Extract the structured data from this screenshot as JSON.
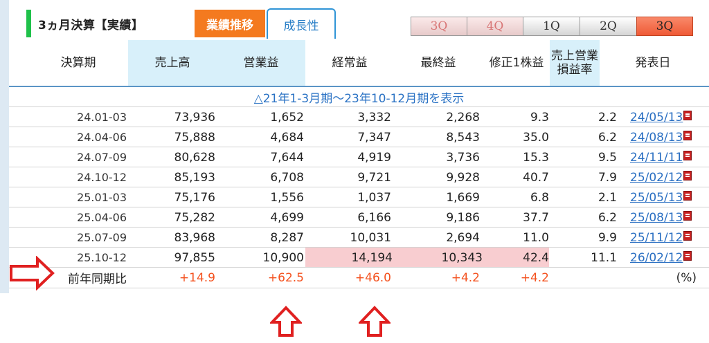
{
  "header": {
    "title": "3ヵ月決算【実績】",
    "tab_active": "業績推移",
    "tab_inactive": "成長性",
    "quarter_tabs": [
      "3Q",
      "4Q",
      "1Q",
      "2Q",
      "3Q"
    ]
  },
  "table": {
    "headers": [
      "決算期",
      "売上高",
      "営業益",
      "経常益",
      "最終益",
      "修正1株益",
      "売上営業\n損益率",
      "発表日"
    ],
    "period_note": "△21年1-3月期～23年10-12月期を表示",
    "rows": [
      {
        "period": "24.01-03",
        "sales": "73,936",
        "operating": "1,652",
        "ordinary": "3,332",
        "net": "2,268",
        "eps": "9.3",
        "margin": "2.2",
        "date": "24/05/13"
      },
      {
        "period": "24.04-06",
        "sales": "75,888",
        "operating": "4,684",
        "ordinary": "7,347",
        "net": "8,543",
        "eps": "35.0",
        "margin": "6.2",
        "date": "24/08/13"
      },
      {
        "period": "24.07-09",
        "sales": "80,628",
        "operating": "7,644",
        "ordinary": "4,919",
        "net": "3,736",
        "eps": "15.3",
        "margin": "9.5",
        "date": "24/11/11"
      },
      {
        "period": "24.10-12",
        "sales": "85,193",
        "operating": "6,708",
        "ordinary": "9,721",
        "net": "9,928",
        "eps": "40.7",
        "margin": "7.9",
        "date": "25/02/12"
      },
      {
        "period": "25.01-03",
        "sales": "75,176",
        "operating": "1,556",
        "ordinary": "1,037",
        "net": "1,669",
        "eps": "6.8",
        "margin": "2.1",
        "date": "25/05/13"
      },
      {
        "period": "25.04-06",
        "sales": "75,282",
        "operating": "4,699",
        "ordinary": "6,166",
        "net": "9,186",
        "eps": "37.7",
        "margin": "6.2",
        "date": "25/08/13"
      },
      {
        "period": "25.07-09",
        "sales": "83,968",
        "operating": "8,287",
        "ordinary": "10,031",
        "net": "2,694",
        "eps": "11.0",
        "margin": "9.9",
        "date": "25/11/12"
      },
      {
        "period": "25.10-12",
        "sales": "97,855",
        "operating": "10,900",
        "ordinary": "14,194",
        "net": "10,343",
        "eps": "42.4",
        "margin": "11.1",
        "date": "26/02/12"
      }
    ],
    "yoy": {
      "label": "前年同期比",
      "sales": "+14.9",
      "operating": "+62.5",
      "ordinary": "+46.0",
      "net": "+4.2",
      "eps": "+4.2",
      "unit": "(%)"
    }
  },
  "colors": {
    "accent_orange": "#f47a1f",
    "header_blue": "#d8f0fa",
    "highlight_pink": "#f8cdd0",
    "positive": "#f4511e",
    "arrow_red": "#e02020"
  }
}
